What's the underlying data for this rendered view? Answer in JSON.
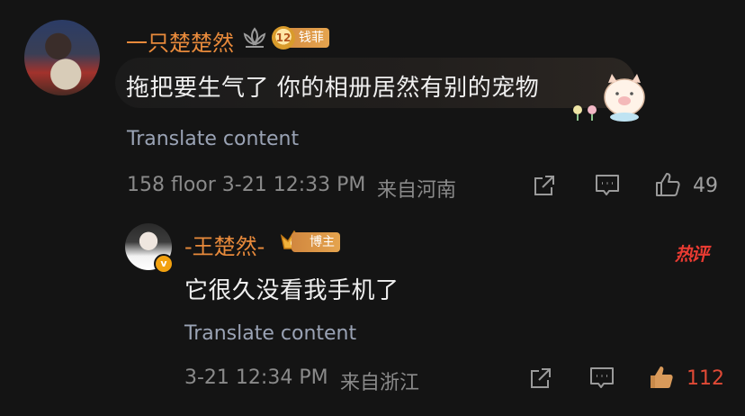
{
  "comment1": {
    "username": "一只楚楚然",
    "badge_level": "12",
    "badge_label": "钱菲",
    "text": "拖把要生气了 你的相册居然有别的宠物",
    "translate": "Translate content",
    "meta": "158 floor 3-21 12:33 PM",
    "location": "来自河南",
    "likes": "49"
  },
  "reply": {
    "username": "-王楚然-",
    "verified_mark": "v",
    "badge_label": "博主",
    "hot_label": "热评",
    "text": "它很久没看我手机了",
    "translate": "Translate content",
    "meta": "3-21 12:34 PM",
    "location": "来自浙江",
    "likes": "112"
  },
  "colors": {
    "background": "#141414",
    "username": "#e88a3b",
    "translate": "#9aa3b5",
    "liked": "#e04a36"
  }
}
